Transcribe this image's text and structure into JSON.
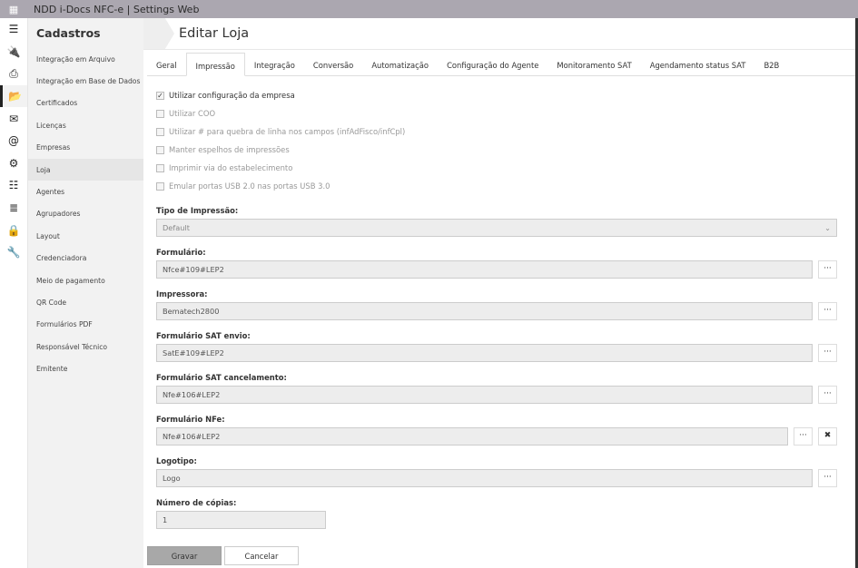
{
  "app": {
    "title": "NDD i-Docs NFC-e | Settings Web"
  },
  "rail": {
    "icons": [
      "menu-icon",
      "plug-icon",
      "printer-icon",
      "folder-open-icon",
      "envelope-icon",
      "at-icon",
      "gear-icon",
      "sliders-icon",
      "server-icon",
      "lock-icon",
      "wrench-icon"
    ],
    "active": 3
  },
  "sidebar": {
    "title": "Cadastros",
    "items": [
      "Integração em Arquivo",
      "Integração em Base de Dados",
      "Certificados",
      "Licenças",
      "Empresas",
      "Loja",
      "Agentes",
      "Agrupadores",
      "Layout",
      "Credenciadora",
      "Meio de pagamento",
      "QR Code",
      "Formulários PDF",
      "Responsável Técnico",
      "Emitente"
    ],
    "active": "Loja"
  },
  "page": {
    "title": "Editar Loja"
  },
  "tabs": [
    "Geral",
    "Impressão",
    "Integração",
    "Conversão",
    "Automatização",
    "Configuração do Agente",
    "Monitoramento SAT",
    "Agendamento status SAT",
    "B2B"
  ],
  "active_tab": "Impressão",
  "checkboxes": [
    {
      "label": "Utilizar configuração da empresa",
      "checked": true
    },
    {
      "label": "Utilizar COO",
      "checked": false
    },
    {
      "label": "Utilizar # para quebra de linha nos campos (infAdFisco/infCpl)",
      "checked": false
    },
    {
      "label": "Manter espelhos de impressões",
      "checked": false
    },
    {
      "label": "Imprimir via do estabelecimento",
      "checked": false
    },
    {
      "label": "Emular portas USB 2.0 nas portas USB 3.0",
      "checked": false
    }
  ],
  "tipo": {
    "label": "Tipo de Impressão:",
    "value": "Default"
  },
  "fields": [
    {
      "label": "Formulário:",
      "value": "Nfce#109#LEP2",
      "clear": false
    },
    {
      "label": "Impressora:",
      "value": "Bematech2800",
      "clear": false
    },
    {
      "label": "Formulário SAT envio:",
      "value": "SatE#109#LEP2",
      "clear": false
    },
    {
      "label": "Formulário SAT cancelamento:",
      "value": "Nfe#106#LEP2",
      "clear": false
    },
    {
      "label": "Formulário NFe:",
      "value": "Nfe#106#LEP2",
      "clear": true
    },
    {
      "label": "Logotipo:",
      "value": "Logo",
      "clear": false
    }
  ],
  "copias": {
    "label": "Número de cópias:",
    "value": "1"
  },
  "buttons": {
    "browse": "···",
    "clear": "✖",
    "save": "Gravar",
    "cancel": "Cancelar"
  }
}
